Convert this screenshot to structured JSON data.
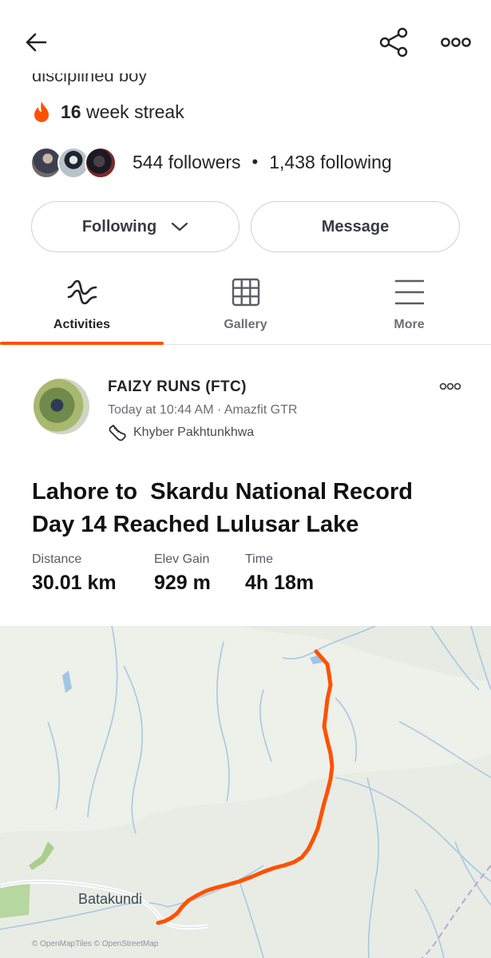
{
  "profile": {
    "bio_tail": "disciplined boy",
    "streak_count": "16",
    "streak_unit": "week streak",
    "followers": "544 followers",
    "following": "1,438 following",
    "separator": "•"
  },
  "buttons": {
    "following_label": "Following",
    "message_label": "Message"
  },
  "tabs": [
    {
      "label": "Activities",
      "active": true
    },
    {
      "label": "Gallery",
      "active": false
    },
    {
      "label": "More",
      "active": false
    }
  ],
  "activity": {
    "athlete": "FAIZY  RUNS (FTC)",
    "meta": "Today at 10:44 AM · Amazfit GTR",
    "location": "Khyber Pakhtunkhwa",
    "title": "Lahore to  Skardu National Record\nDay 14 Reached Lulusar Lake",
    "stats": [
      {
        "label": "Distance",
        "value": "30.01 km"
      },
      {
        "label": "Elev Gain",
        "value": "929 m"
      },
      {
        "label": "Time",
        "value": "4h 18m"
      }
    ]
  },
  "map": {
    "place_label": "Batakundi",
    "attribution": "© OpenMapTiles © OpenStreetMap",
    "route_color": "#fc5200"
  },
  "colors": {
    "accent": "#fc5200",
    "streak_flame": "#fc5200"
  },
  "icons": [
    "back-arrow-icon",
    "share-icon",
    "more-dots-icon",
    "flame-icon",
    "chevron-down-icon",
    "activity-pulse-icon",
    "grid-icon",
    "menu-lines-icon",
    "shoe-icon"
  ]
}
